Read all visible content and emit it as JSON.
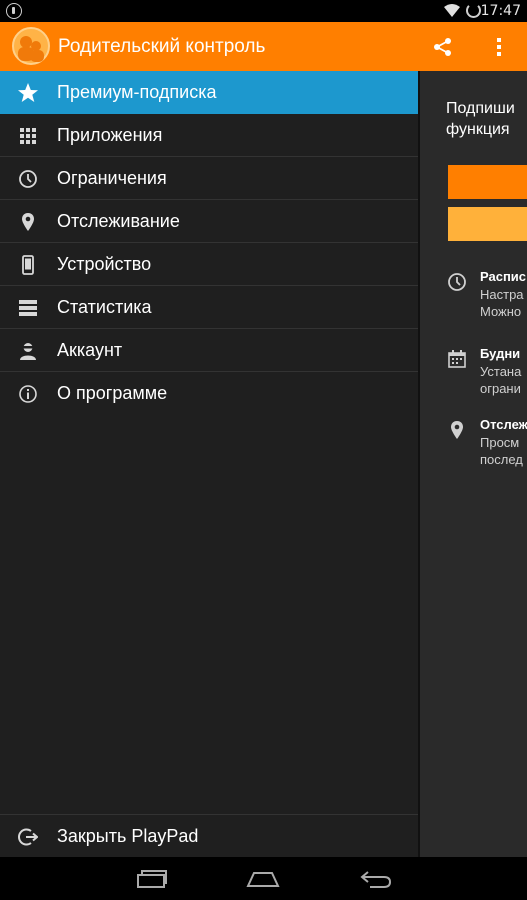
{
  "status_bar": {
    "time": "17:47"
  },
  "app_bar": {
    "title": "Родительский контроль",
    "share_icon": "share-icon",
    "overflow_icon": "more-vert-icon"
  },
  "drawer": {
    "items": [
      {
        "label": "Премиум-подписка",
        "icon": "star-icon",
        "active": true
      },
      {
        "label": "Приложения",
        "icon": "apps-grid-icon"
      },
      {
        "label": "Ограничения",
        "icon": "clock-icon"
      },
      {
        "label": "Отслеживание",
        "icon": "location-pin-icon"
      },
      {
        "label": "Устройство",
        "icon": "phone-icon"
      },
      {
        "label": "Статистика",
        "icon": "stats-list-icon"
      },
      {
        "label": "Аккаунт",
        "icon": "person-icon"
      },
      {
        "label": "О программе",
        "icon": "info-icon"
      }
    ],
    "footer": {
      "label": "Закрыть PlayPad",
      "icon": "exit-icon"
    }
  },
  "main": {
    "headline_line1": "Подпиши",
    "headline_line2": "функция",
    "features": [
      {
        "title": "Распис",
        "line1": "Настра",
        "line2": "Можно",
        "icon": "clock-icon"
      },
      {
        "title": "Будни",
        "line1": "Устана",
        "line2": "ограни",
        "icon": "calendar-icon"
      },
      {
        "title": "Отслеж",
        "line1": "Просм",
        "line2": "послед",
        "icon": "location-pin-icon"
      }
    ]
  },
  "colors": {
    "accent_orange": "#ff7f00",
    "light_orange": "#ffb13a",
    "active_blue": "#1d98ce",
    "drawer_bg": "#1f1f1f"
  }
}
